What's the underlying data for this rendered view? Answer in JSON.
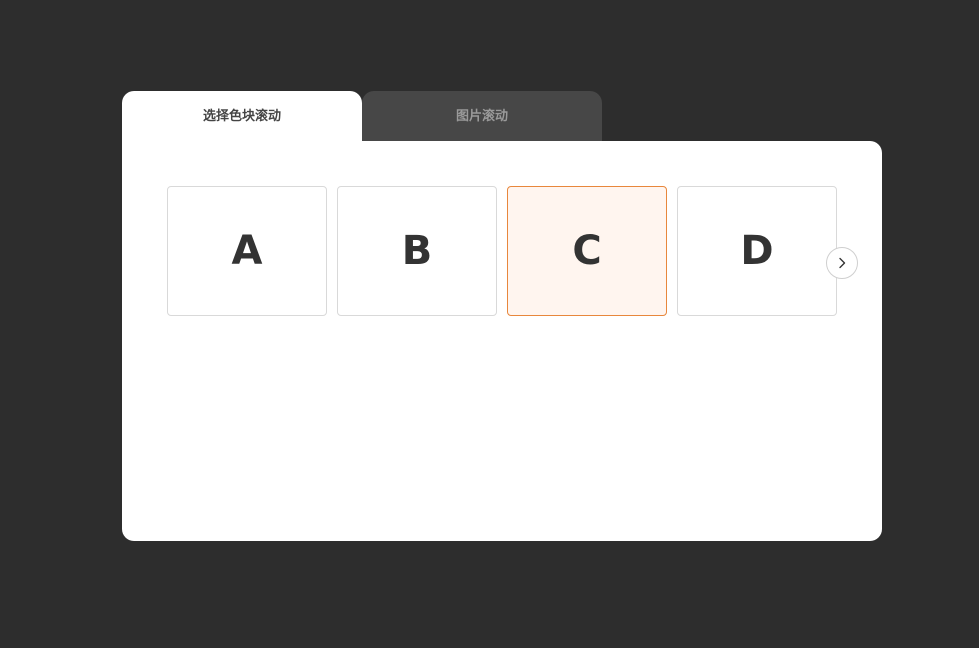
{
  "tabs": [
    {
      "label": "选择色块滚动",
      "active": true
    },
    {
      "label": "图片滚动",
      "active": false
    }
  ],
  "tiles": [
    {
      "label": "A",
      "selected": false
    },
    {
      "label": "B",
      "selected": false
    },
    {
      "label": "C",
      "selected": true
    },
    {
      "label": "D",
      "selected": false
    }
  ],
  "next_button": {
    "icon": "chevron-right-icon"
  },
  "colors": {
    "background": "#2d2d2d",
    "panel": "#ffffff",
    "inactive_tab": "#474747",
    "selected_border": "#e8873c",
    "selected_fill": "#fff5ef",
    "tile_text": "#333333"
  }
}
